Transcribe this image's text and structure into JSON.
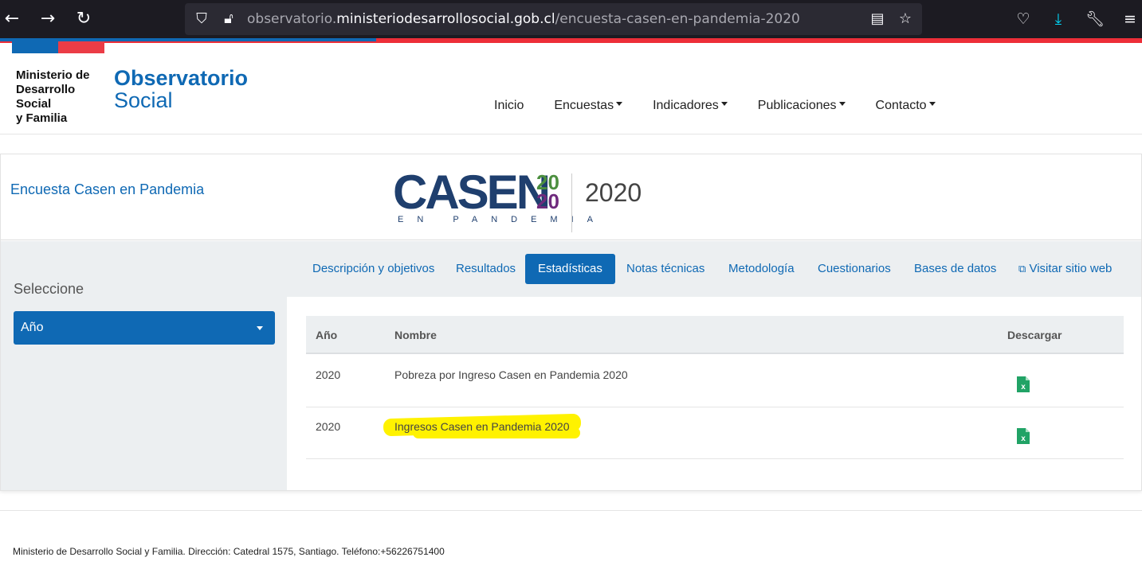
{
  "browser": {
    "back_icon": "arrow-left-icon",
    "forward_icon": "arrow-right-icon",
    "reload_icon": "reload-icon",
    "url_prefix": "observatorio.",
    "url_domain": "ministeriodesarrollosocial.gob.cl",
    "url_path": "/encuesta-casen-en-pandemia-2020"
  },
  "header": {
    "ministry_lines": [
      "Ministerio de",
      "Desarrollo",
      "Social",
      "y Familia"
    ],
    "brand_line1": "Observatorio",
    "brand_line2": "Social",
    "nav": [
      {
        "label": "Inicio",
        "dropdown": false
      },
      {
        "label": "Encuestas",
        "dropdown": true
      },
      {
        "label": "Indicadores",
        "dropdown": true
      },
      {
        "label": "Publicaciones",
        "dropdown": true
      },
      {
        "label": "Contacto",
        "dropdown": true
      }
    ]
  },
  "survey": {
    "title": "Encuesta Casen en Pandemia",
    "logo_word": "CASEN",
    "logo_year_top": "20",
    "logo_year_bottom": "20",
    "logo_sub": "EN PANDEMIA",
    "year": "2020"
  },
  "sidebar": {
    "select_label": "Seleccione",
    "dropdown_value": "Año"
  },
  "tabs": [
    {
      "label": "Descripción y objetivos",
      "active": false
    },
    {
      "label": "Resultados",
      "active": false
    },
    {
      "label": "Estadísticas",
      "active": true
    },
    {
      "label": "Notas técnicas",
      "active": false
    },
    {
      "label": "Metodología",
      "active": false
    },
    {
      "label": "Cuestionarios",
      "active": false
    },
    {
      "label": "Bases de datos",
      "active": false
    },
    {
      "label": "Visitar sitio web",
      "active": false,
      "icon": "external-link-icon"
    }
  ],
  "table": {
    "headers": [
      "Año",
      "Nombre",
      "Descargar"
    ],
    "rows": [
      {
        "year": "2020",
        "name": "Pobreza por Ingreso Casen en Pandemia 2020",
        "download_icon": "excel-file-icon"
      },
      {
        "year": "2020",
        "name": "Ingresos Casen en Pandemia 2020",
        "download_icon": "excel-file-icon",
        "highlighted": true
      }
    ]
  },
  "colors": {
    "brand_blue": "#0f69b4",
    "brand_red": "#eb3c46",
    "highlight_yellow": "#fff200",
    "excel_green": "#21a366"
  },
  "footer": {
    "text": "Ministerio de Desarrollo Social y Familia. Dirección: Catedral 1575, Santiago. Teléfono:+56226751400"
  }
}
